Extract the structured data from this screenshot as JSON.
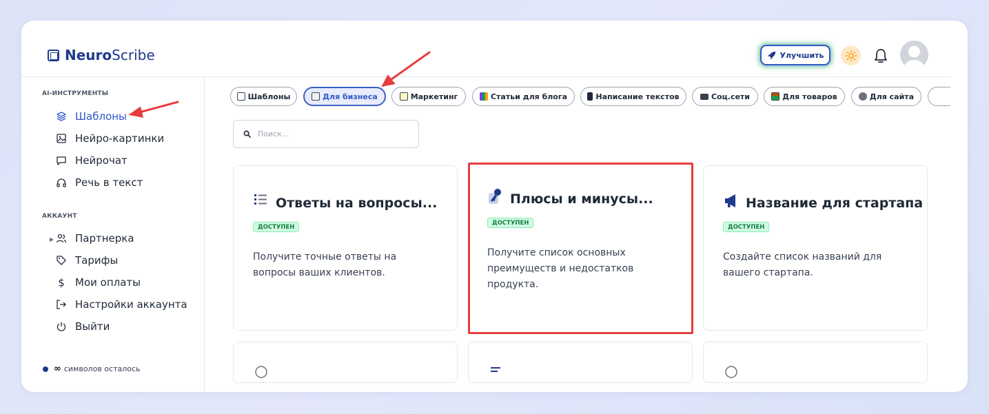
{
  "header": {
    "logo_bold": "Neuro",
    "logo_rest": "Scribe",
    "upgrade_label": "Улучшить"
  },
  "sidebar": {
    "tools_title": "AI-ИНСТРУМЕНТЫ",
    "tools": [
      {
        "label": "Шаблоны",
        "icon": "layers-icon",
        "active": true
      },
      {
        "label": "Нейро-картинки",
        "icon": "image-icon"
      },
      {
        "label": "Нейрочат",
        "icon": "chat-icon"
      },
      {
        "label": "Речь в текст",
        "icon": "headphones-icon"
      }
    ],
    "account_title": "АККАУНТ",
    "account": [
      {
        "label": "Партнерка",
        "icon": "users-icon"
      },
      {
        "label": "Тарифы",
        "icon": "tag-icon"
      },
      {
        "label": "Мои оплаты",
        "icon": "dollar-icon"
      },
      {
        "label": "Настройки аккаунта",
        "icon": "login-icon"
      },
      {
        "label": "Выйти",
        "icon": "power-icon"
      }
    ],
    "chars_symbol": "∞",
    "chars_label": "символов осталось"
  },
  "chips": [
    {
      "label": "Шаблоны"
    },
    {
      "label": "Для бизнеса",
      "active": true
    },
    {
      "label": "Маркетинг"
    },
    {
      "label": "Статьи для блога"
    },
    {
      "label": "Написание текстов"
    },
    {
      "label": "Соц.сети"
    },
    {
      "label": "Для товаров"
    },
    {
      "label": "Для сайта"
    }
  ],
  "search": {
    "placeholder": "Поиск..."
  },
  "cards": [
    {
      "title": "Ответы на вопросы...",
      "badge": "ДОСТУПЕН",
      "desc": "Получите точные ответы на вопросы ваших клиентов.",
      "icon": "list-icon"
    },
    {
      "title": "Плюсы и минусы...",
      "badge": "ДОСТУПЕН",
      "desc": "Получите список основных преимуществ и недостатков продукта.",
      "icon": "key-icon"
    },
    {
      "title": "Название для стартапа",
      "badge": "ДОСТУПЕН",
      "desc": "Создайте список названий для вашего стартапа.",
      "icon": "megaphone-icon"
    }
  ],
  "colors": {
    "accent": "#2f57c9",
    "brand": "#1e3a8a",
    "annotation": "#e53e3e",
    "badge_bg": "#d1fae5"
  }
}
